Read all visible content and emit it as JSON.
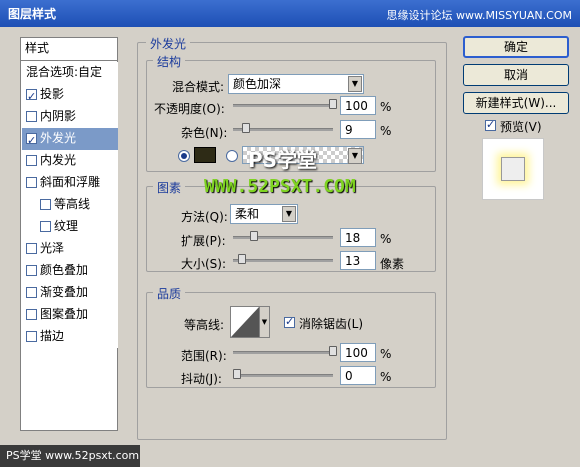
{
  "window": {
    "title": "图层样式",
    "top_watermark": "思缘设计论坛 www.MISSYUAN.COM"
  },
  "sidebar": {
    "header": "样式",
    "blend_options": "混合选项:自定",
    "items": [
      {
        "label": "投影",
        "checked": true
      },
      {
        "label": "内阴影",
        "checked": false
      },
      {
        "label": "外发光",
        "checked": true,
        "selected": true
      },
      {
        "label": "内发光",
        "checked": false
      },
      {
        "label": "斜面和浮雕",
        "checked": false
      },
      {
        "label": "等高线",
        "checked": false
      },
      {
        "label": "纹理",
        "checked": false
      },
      {
        "label": "光泽",
        "checked": false
      },
      {
        "label": "颜色叠加",
        "checked": false
      },
      {
        "label": "渐变叠加",
        "checked": false
      },
      {
        "label": "图案叠加",
        "checked": false
      },
      {
        "label": "描边",
        "checked": false
      }
    ]
  },
  "outer_glow": {
    "title": "外发光",
    "structure": {
      "title": "结构",
      "blend_mode_label": "混合模式:",
      "blend_mode": "颜色加深",
      "opacity_label": "不透明度(O):",
      "opacity": "100",
      "opacity_unit": "%",
      "opacity_level": 1.0,
      "noise_label": "杂色(N):",
      "noise": "9",
      "noise_unit": "%",
      "noise_level": 0.09,
      "color": "#2e2b16"
    },
    "elements": {
      "title": "图素",
      "method_label": "方法(Q):",
      "method": "柔和",
      "spread_label": "扩展(P):",
      "spread": "18",
      "spread_unit": "%",
      "spread_level": 0.18,
      "size_label": "大小(S):",
      "size": "13",
      "size_unit": "像素",
      "size_level": 0.05
    },
    "quality": {
      "title": "品质",
      "contour_label": "等高线:",
      "antialias_label": "消除锯齿(L)",
      "antialias": true,
      "range_label": "范围(R):",
      "range": "100",
      "range_unit": "%",
      "range_level": 1.0,
      "jitter_label": "抖动(J):",
      "jitter": "0",
      "jitter_unit": "%",
      "jitter_level": 0.0
    }
  },
  "buttons": {
    "ok": "确定",
    "cancel": "取消",
    "new_style": "新建样式(W)...",
    "preview": "预览(V)",
    "preview_checked": true
  },
  "watermarks": {
    "ps": "PS学堂",
    "url": "WWW.52PSXT.COM",
    "footer": "PS学堂 www.52psxt.com"
  }
}
